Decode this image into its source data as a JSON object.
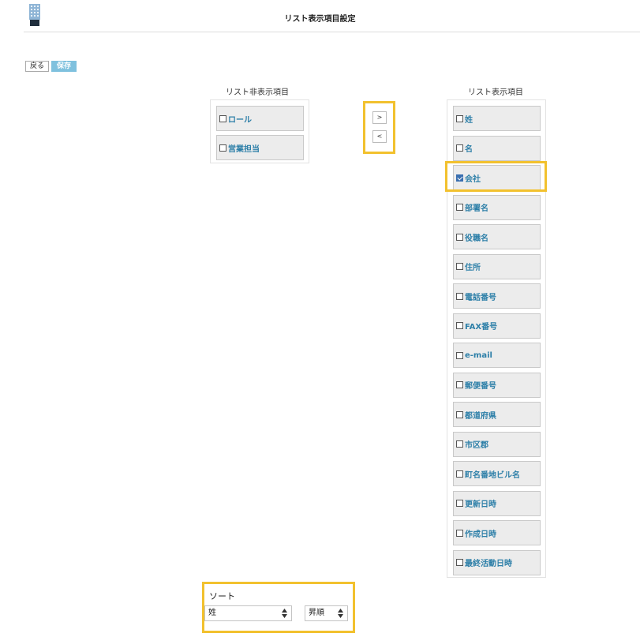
{
  "header": {
    "title": "リスト表示項目設定",
    "logo_icon": "building-icon"
  },
  "toolbar": {
    "back_label": "戻る",
    "save_label": "保存",
    "save_color": "#7fc1de"
  },
  "hidden_column": {
    "title": "リスト非表示項目",
    "items": [
      {
        "label": "ロール",
        "checked": false
      },
      {
        "label": "営業担当",
        "checked": false
      }
    ]
  },
  "move_buttons": {
    "to_visible": ">",
    "to_hidden": "<"
  },
  "visible_column": {
    "title": "リスト表示項目",
    "items": [
      {
        "label": "姓",
        "checked": false
      },
      {
        "label": "名",
        "checked": false
      },
      {
        "label": "会社",
        "checked": true
      },
      {
        "label": "部署名",
        "checked": false
      },
      {
        "label": "役職名",
        "checked": false
      },
      {
        "label": "住所",
        "checked": false
      },
      {
        "label": "電話番号",
        "checked": false
      },
      {
        "label": "FAX番号",
        "checked": false
      },
      {
        "label": "e-mail",
        "checked": false
      },
      {
        "label": "郵便番号",
        "checked": false
      },
      {
        "label": "都道府県",
        "checked": false
      },
      {
        "label": "市区郡",
        "checked": false
      },
      {
        "label": "町名番地ビル名",
        "checked": false
      },
      {
        "label": "更新日時",
        "checked": false
      },
      {
        "label": "作成日時",
        "checked": false
      },
      {
        "label": "最終活動日時",
        "checked": false
      }
    ]
  },
  "sort": {
    "label": "ソート",
    "field_value": "姓",
    "order_value": "昇順"
  },
  "colors": {
    "highlight": "#f2c12e",
    "item_text": "#2d7fa8",
    "item_bg": "#ececec"
  }
}
